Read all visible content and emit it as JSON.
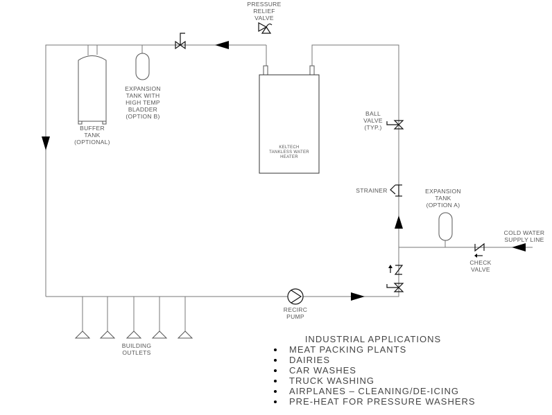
{
  "labels": {
    "pressure_relief_valve": [
      "PRESSURE",
      "RELIEF",
      "VALVE"
    ],
    "expansion_tank_b": [
      "EXPANSION",
      "TANK WITH",
      "HIGH TEMP",
      "BLADDER",
      "(OPTION B)"
    ],
    "buffer_tank": [
      "BUFFER",
      "TANK",
      "(OPTIONAL)"
    ],
    "water_heater": [
      "KELTECH",
      "TANKLESS WATER",
      "HEATER"
    ],
    "ball_valve": [
      "BALL",
      "VALVE",
      "(TYP.)"
    ],
    "strainer": "STRAINER",
    "expansion_tank_a": [
      "EXPANSION",
      "TANK",
      "(OPTION A)"
    ],
    "cold_water": [
      "COLD WATER",
      "SUPPLY LINE"
    ],
    "check_valve": [
      "CHECK",
      "VALVE"
    ],
    "recirc_pump": [
      "RECIRC",
      "PUMP"
    ],
    "building_outlets": [
      "BUILDING",
      "OUTLETS"
    ]
  },
  "applications": {
    "title": "INDUSTRIAL APPLICATIONS",
    "items": [
      "MEAT PACKING PLANTS",
      "DAIRIES",
      "CAR WASHES",
      "TRUCK WASHING",
      "AIRPLANES – CLEANING/DE-ICING",
      "PRE-HEAT FOR PRESSURE WASHERS"
    ]
  }
}
